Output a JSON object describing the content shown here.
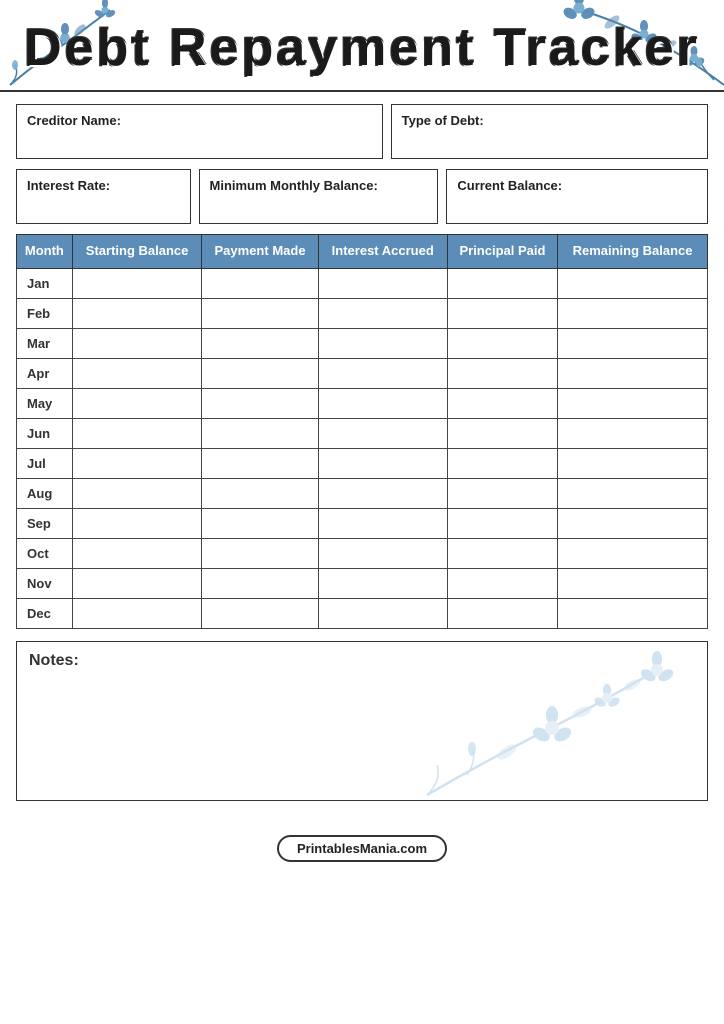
{
  "header": {
    "title": "Debt Repayment Tracker"
  },
  "info_fields": {
    "creditor_label": "Creditor Name:",
    "type_label": "Type of Debt:",
    "interest_label": "Interest Rate:",
    "minimum_label": "Minimum Monthly Balance:",
    "current_label": "Current Balance:"
  },
  "table": {
    "headers": [
      "Month",
      "Starting Balance",
      "Payment Made",
      "Interest Accrued",
      "Principal Paid",
      "Remaining Balance"
    ],
    "rows": [
      {
        "month": "Jan"
      },
      {
        "month": "Feb"
      },
      {
        "month": "Mar"
      },
      {
        "month": "Apr"
      },
      {
        "month": "May"
      },
      {
        "month": "Jun"
      },
      {
        "month": "Jul"
      },
      {
        "month": "Aug"
      },
      {
        "month": "Sep"
      },
      {
        "month": "Oct"
      },
      {
        "month": "Nov"
      },
      {
        "month": "Dec"
      }
    ]
  },
  "notes": {
    "label": "Notes:"
  },
  "footer": {
    "label": "PrintablesMania.com"
  },
  "colors": {
    "header_bg": "#5b8db8",
    "accent_blue": "#7aafd4",
    "light_blue": "#b8d4e8"
  }
}
